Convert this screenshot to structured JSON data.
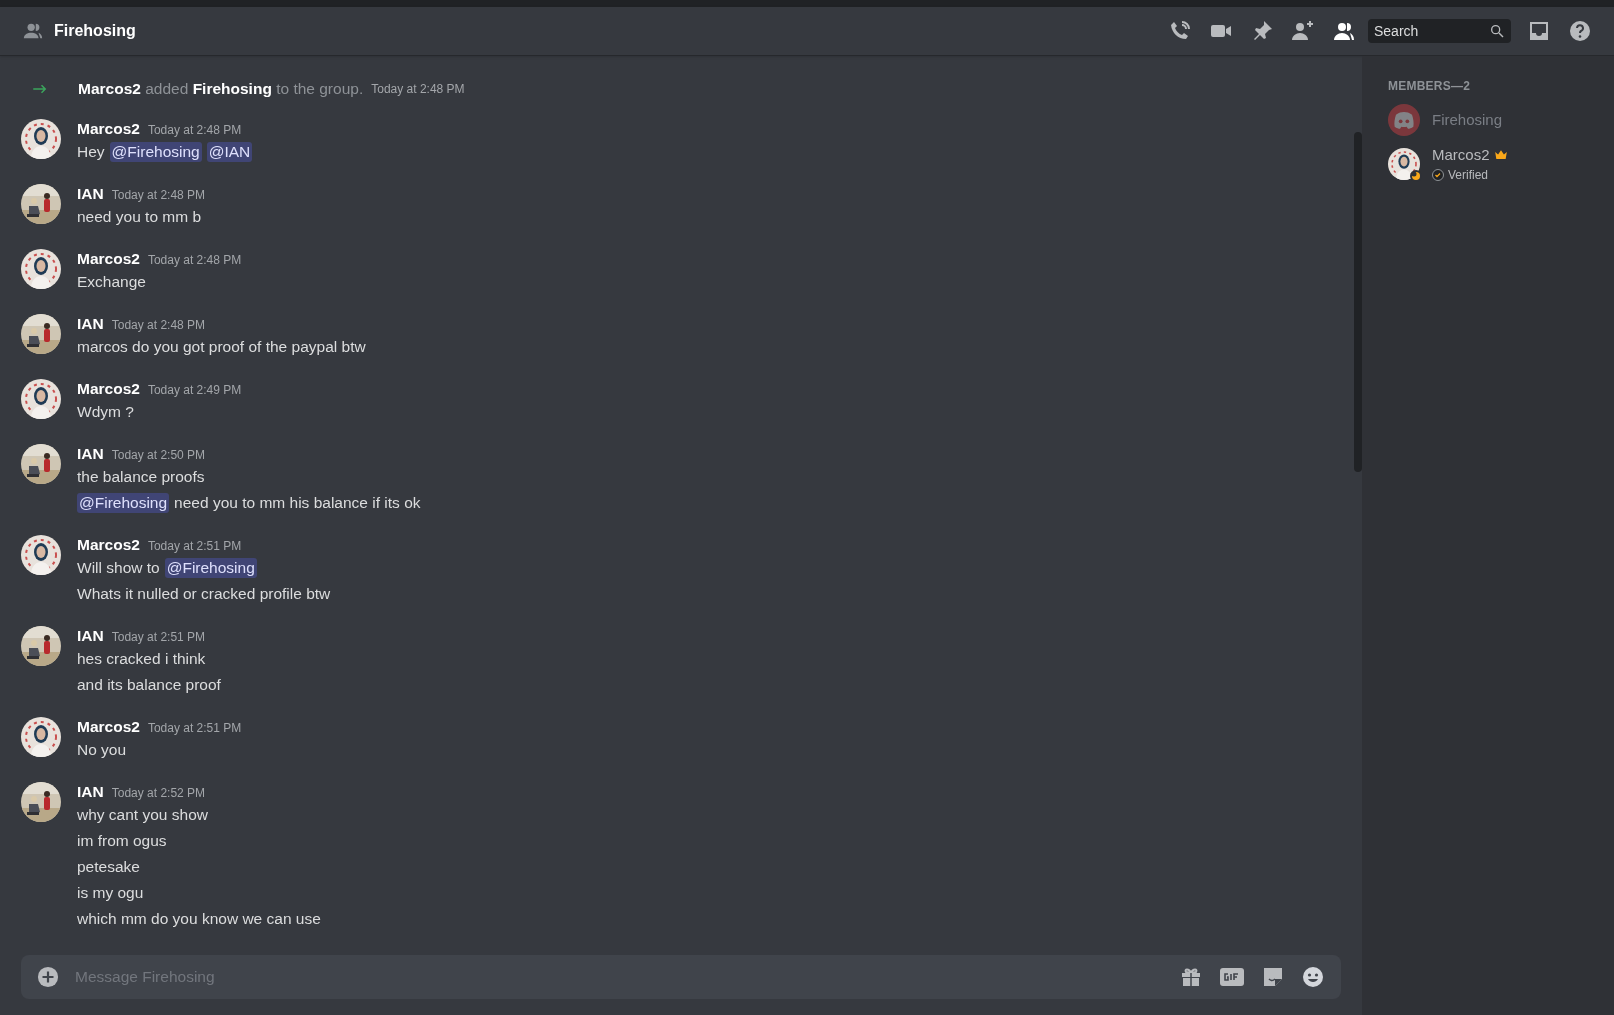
{
  "header": {
    "title": "Firehosing",
    "search": {
      "placeholder": "Search"
    }
  },
  "system_message": {
    "actor": "Marcos2",
    "verb": "added",
    "target": "Firehosing",
    "rest": "to the group.",
    "time": "Today at 2:48 PM"
  },
  "messages": [
    {
      "author": "Marcos2",
      "time": "Today at 2:48 PM",
      "lines": [
        [
          {
            "kind": "text",
            "text": "Hey"
          },
          {
            "kind": "mention",
            "text": "@Firehosing"
          },
          {
            "kind": "mention",
            "text": "@IAN"
          }
        ]
      ]
    },
    {
      "author": "IAN",
      "time": "Today at 2:48 PM",
      "lines": [
        [
          {
            "kind": "text",
            "text": "need you to mm b"
          }
        ]
      ]
    },
    {
      "author": "Marcos2",
      "time": "Today at 2:48 PM",
      "lines": [
        [
          {
            "kind": "text",
            "text": "Exchange"
          }
        ]
      ]
    },
    {
      "author": "IAN",
      "time": "Today at 2:48 PM",
      "lines": [
        [
          {
            "kind": "text",
            "text": "marcos do you got proof of the paypal btw"
          }
        ]
      ]
    },
    {
      "author": "Marcos2",
      "time": "Today at 2:49 PM",
      "lines": [
        [
          {
            "kind": "text",
            "text": "Wdym ?"
          }
        ]
      ]
    },
    {
      "author": "IAN",
      "time": "Today at 2:50 PM",
      "lines": [
        [
          {
            "kind": "text",
            "text": "the balance proofs"
          }
        ],
        [
          {
            "kind": "mention",
            "text": "@Firehosing"
          },
          {
            "kind": "text",
            "text": "need you to mm his balance if its ok"
          }
        ]
      ]
    },
    {
      "author": "Marcos2",
      "time": "Today at 2:51 PM",
      "lines": [
        [
          {
            "kind": "text",
            "text": "Will show to"
          },
          {
            "kind": "mention",
            "text": "@Firehosing"
          }
        ],
        [
          {
            "kind": "text",
            "text": "Whats it nulled or cracked profile btw"
          }
        ]
      ]
    },
    {
      "author": "IAN",
      "time": "Today at 2:51 PM",
      "lines": [
        [
          {
            "kind": "text",
            "text": "hes cracked i think"
          }
        ],
        [
          {
            "kind": "text",
            "text": "and its balance proof"
          }
        ]
      ]
    },
    {
      "author": "Marcos2",
      "time": "Today at 2:51 PM",
      "lines": [
        [
          {
            "kind": "text",
            "text": "No you"
          }
        ]
      ]
    },
    {
      "author": "IAN",
      "time": "Today at 2:52 PM",
      "lines": [
        [
          {
            "kind": "text",
            "text": "why cant you show"
          }
        ],
        [
          {
            "kind": "text",
            "text": "im from ogus"
          }
        ],
        [
          {
            "kind": "text",
            "text": "petesake"
          }
        ],
        [
          {
            "kind": "text",
            "text": "is my ogu"
          }
        ],
        [
          {
            "kind": "text",
            "text": "which mm do you know we can use"
          }
        ]
      ]
    }
  ],
  "composer": {
    "placeholder": "Message Firehosing"
  },
  "members": {
    "heading": "MEMBERS—2",
    "items": [
      {
        "name": "Firehosing",
        "offline": true,
        "owner": false
      },
      {
        "name": "Marcos2",
        "offline": false,
        "owner": true,
        "status": "Verified"
      }
    ]
  }
}
